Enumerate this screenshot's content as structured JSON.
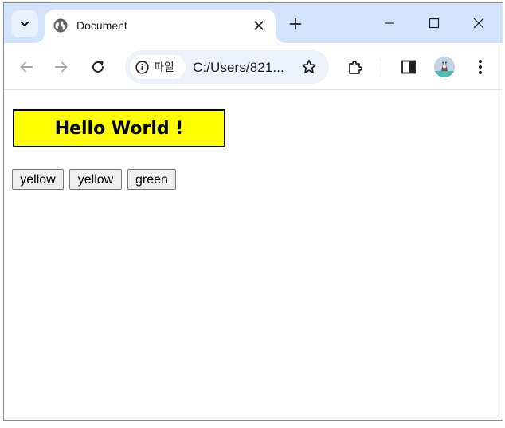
{
  "tab": {
    "title": "Document"
  },
  "omnibox": {
    "site_label": "파일",
    "url": "C:/Users/821..."
  },
  "page": {
    "heading": "Hello World !",
    "buttons": [
      {
        "label": "yellow"
      },
      {
        "label": "yellow"
      },
      {
        "label": "green"
      }
    ]
  },
  "colors": {
    "tabstrip": "#d3e3fd",
    "heading_bg": "#ffff00",
    "omnibox_bg": "#edf2fa"
  },
  "icons": {
    "tab_search": "chevron-down-icon",
    "favicon": "globe-icon",
    "tab_close": "close-icon",
    "new_tab": "plus-icon",
    "back": "arrow-left-icon",
    "forward": "arrow-right-icon",
    "reload": "reload-icon",
    "site_info": "info-icon",
    "bookmark": "star-icon",
    "extensions": "puzzle-icon",
    "side_panel": "side-panel-icon",
    "menu": "more-vert-icon"
  }
}
